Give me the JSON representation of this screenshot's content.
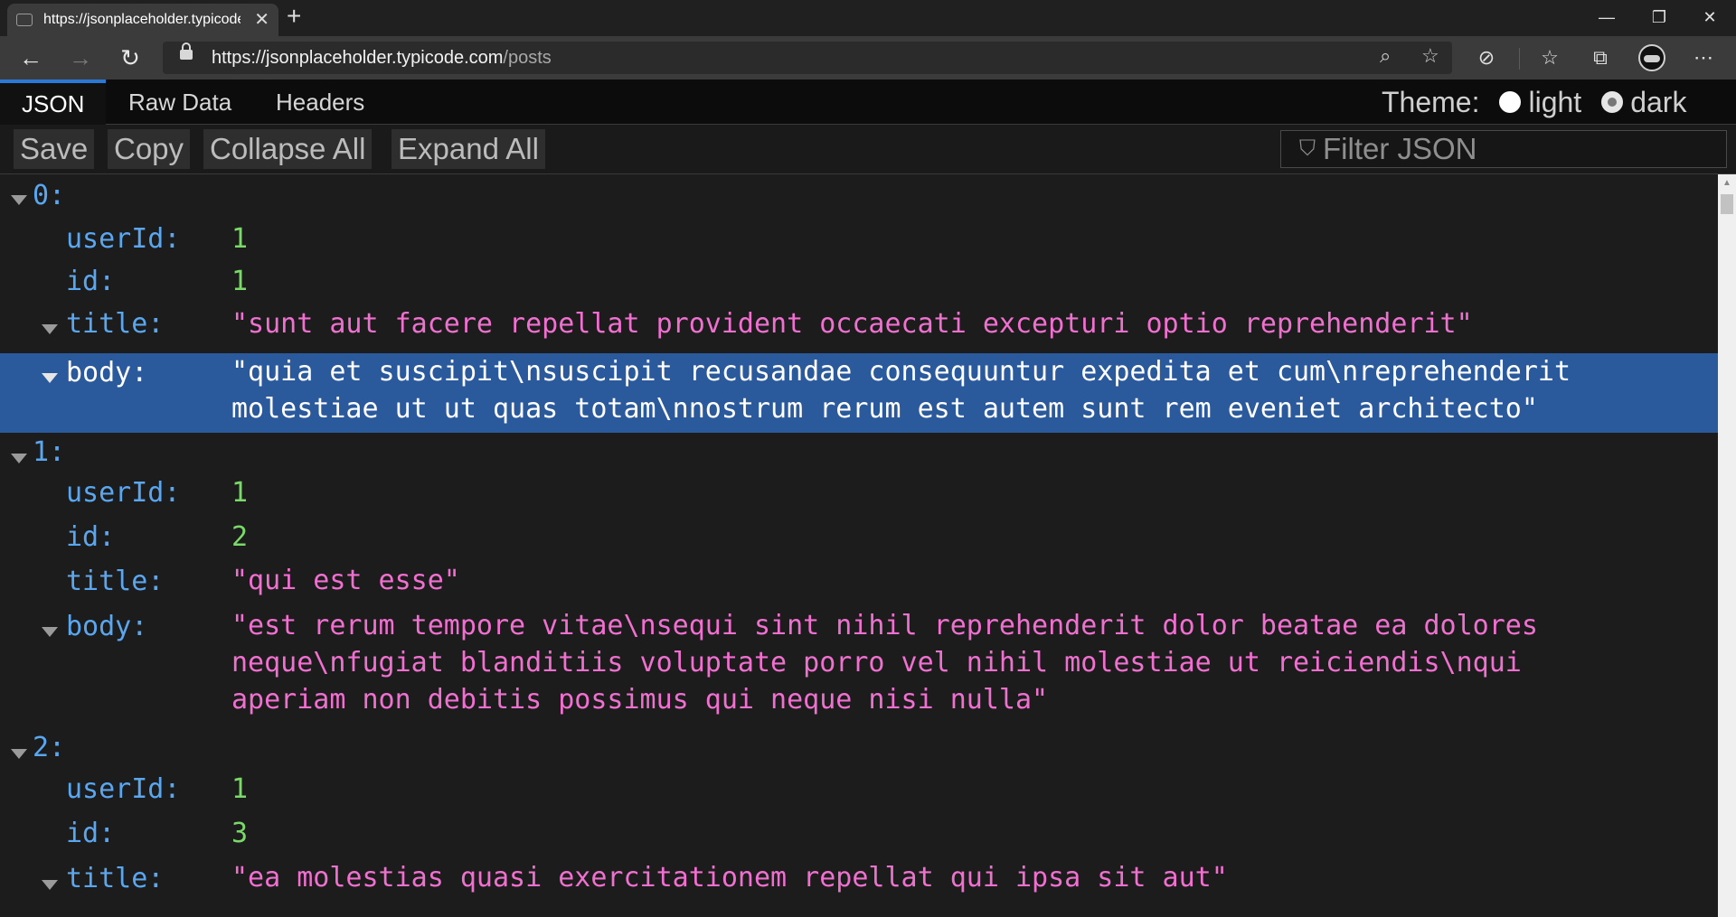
{
  "browser": {
    "tab_title": "https://jsonplaceholder.typicode.com/posts",
    "url_host": "https://jsonplaceholder.typicode.com",
    "url_path": "/posts",
    "icons": {
      "back": "arrow-left-icon",
      "forward": "arrow-right-icon",
      "refresh": "refresh-icon",
      "lock": "lock-icon",
      "zoom": "zoom-icon",
      "favorite": "star-icon",
      "extension": "extension-icon",
      "favorites": "favorites-list-icon",
      "collections": "collections-icon",
      "profile": "avatar",
      "menu": "more-icon"
    }
  },
  "viewer": {
    "tabs": [
      "JSON",
      "Raw Data",
      "Headers"
    ],
    "active_tab": "JSON",
    "theme_label": "Theme:",
    "theme_options": [
      "light",
      "dark"
    ],
    "theme_selected": "dark",
    "toolbar": {
      "save": "Save",
      "copy": "Copy",
      "collapse_all": "Collapse All",
      "expand_all": "Expand All",
      "filter_placeholder": "Filter JSON"
    }
  },
  "posts": [
    {
      "index": "0:",
      "userId_key": "userId:",
      "userId": "1",
      "id_key": "id:",
      "id": "1",
      "title_key": "title:",
      "title": "\"sunt aut facere repellat provident occaecati excepturi optio reprehenderit\"",
      "body_key": "body:",
      "body_line1": "\"quia et suscipit\\nsuscipit recusandae consequuntur expedita et cum\\nreprehenderit",
      "body_line2": "molestiae ut ut quas totam\\nnostrum rerum est autem sunt rem eveniet architecto\""
    },
    {
      "index": "1:",
      "userId_key": "userId:",
      "userId": "1",
      "id_key": "id:",
      "id": "2",
      "title_key": "title:",
      "title": "\"qui est esse\"",
      "body_key": "body:",
      "body_line1": "\"est rerum tempore vitae\\nsequi sint nihil reprehenderit dolor beatae ea dolores",
      "body_line2": "neque\\nfugiat blanditiis voluptate porro vel nihil molestiae ut reiciendis\\nqui",
      "body_line3": "aperiam non debitis possimus qui neque nisi nulla\""
    },
    {
      "index": "2:",
      "userId_key": "userId:",
      "userId": "1",
      "id_key": "id:",
      "id": "3",
      "title_key": "title:",
      "title": "\"ea molestias quasi exercitationem repellat qui ipsa sit aut\""
    }
  ],
  "colors": {
    "key": "#5aa7f0",
    "number": "#7bd96a",
    "string": "#f070d0",
    "selected_row": "#2a5a9c",
    "active_tab_accent": "#2b79d6"
  }
}
